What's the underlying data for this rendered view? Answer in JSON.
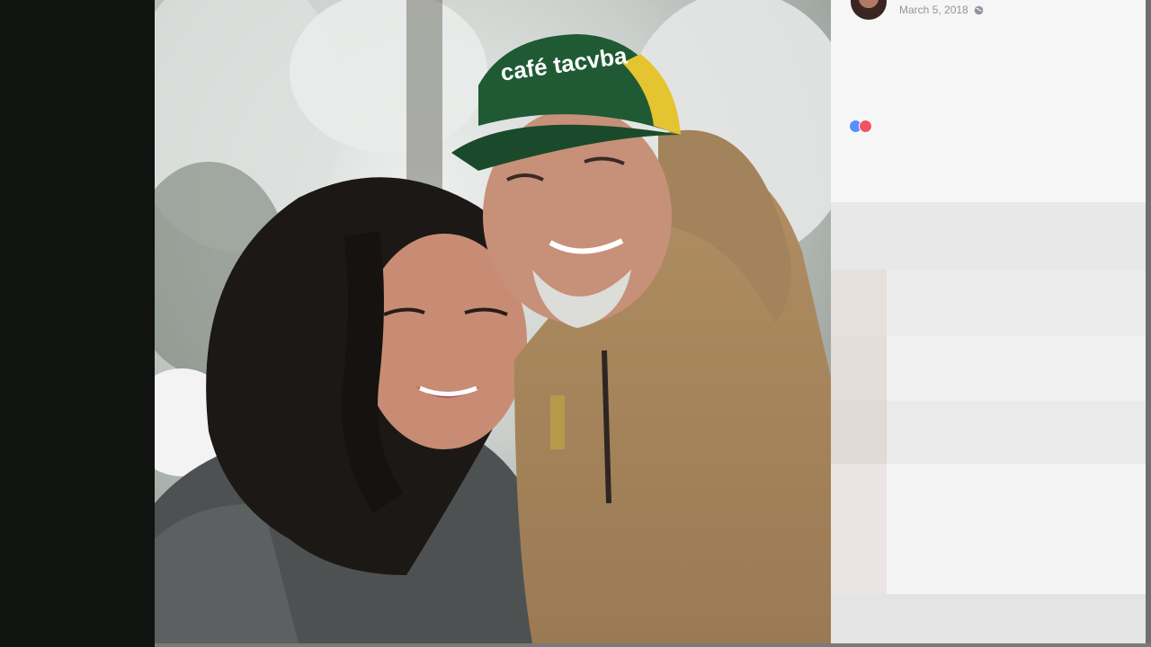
{
  "post": {
    "timestamp": "March 5, 2018",
    "privacy_icon": "globe-icon",
    "reactions": [
      "like-reaction-icon",
      "love-reaction-icon"
    ]
  },
  "photo": {
    "cap_text": "café tacvba"
  },
  "colors": {
    "letterbox": "#111311",
    "panel": "#f6f6f6",
    "timestamp": "#90949c",
    "like": "#5890ff",
    "love": "#f25268"
  }
}
